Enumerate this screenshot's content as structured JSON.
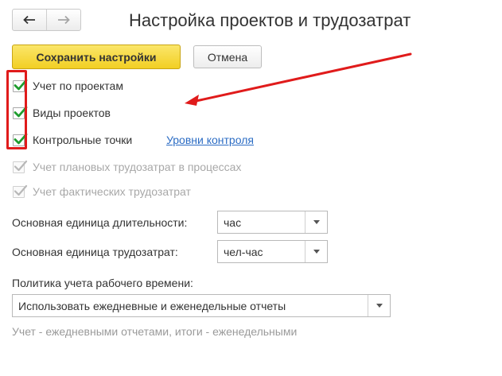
{
  "header": {
    "title": "Настройка проектов и трудозатрат"
  },
  "toolbar": {
    "save_label": "Сохранить настройки",
    "cancel_label": "Отмена"
  },
  "options": {
    "projects_accounting": {
      "label": "Учет по проектам",
      "checked": true
    },
    "project_types": {
      "label": "Виды проектов",
      "checked": true
    },
    "checkpoints": {
      "label": "Контрольные точки",
      "checked": true,
      "link": "Уровни контроля"
    },
    "planned_labor": {
      "label": "Учет плановых трудозатрат в процессах",
      "checked": true,
      "disabled": true
    },
    "actual_labor": {
      "label": "Учет фактических трудозатрат",
      "checked": true,
      "disabled": true
    }
  },
  "duration_unit": {
    "label": "Основная единица длительности:",
    "value": "час"
  },
  "labor_unit": {
    "label": "Основная единица трудозатрат:",
    "value": "чел-час"
  },
  "time_policy": {
    "label": "Политика учета рабочего времени:",
    "value": "Использовать ежедневные и еженедельные отчеты",
    "hint": "Учет - ежедневными отчетами, итоги - еженедельными"
  },
  "colors": {
    "accent_yellow": "#f2cf23",
    "checkmark_green": "#1e9c2e",
    "annotation_red": "#e01b1b",
    "link_blue": "#2b6cc4"
  }
}
